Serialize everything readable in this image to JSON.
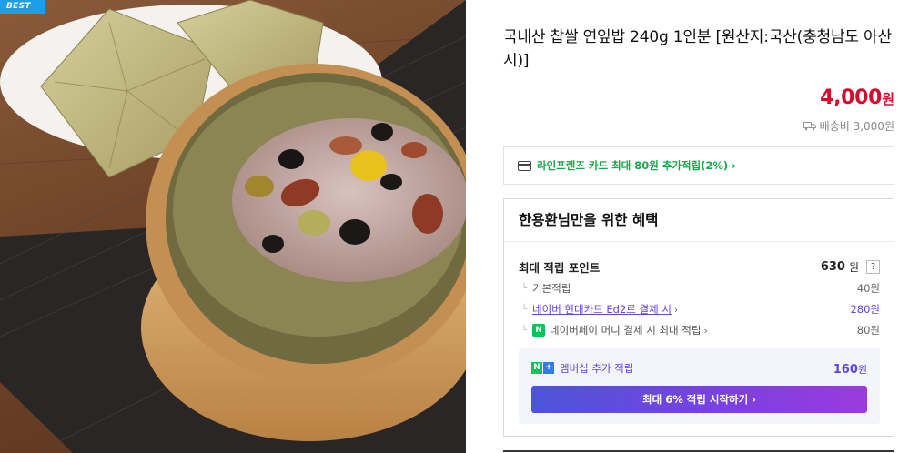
{
  "image": {
    "badge": "BEST"
  },
  "product": {
    "title": "국내산 찹쌀 연잎밥 240g 1인분 [원산지:국산(충청남도 아산시)]",
    "price": "4,000",
    "price_unit": "원",
    "shipping": "배송비 3,000원"
  },
  "card_promo": {
    "text": "라인프렌즈 카드 최대 80원 추가적립(2%) ›"
  },
  "benefits": {
    "title": "한용환님만을 위한 혜택",
    "max_points_label": "최대 적립 포인트",
    "max_points_value": "630",
    "max_points_unit": "원",
    "help": "?",
    "rows": [
      {
        "label": "기본적립",
        "value": "40원"
      },
      {
        "label": "네이버 현대카드 Ed2로 결제 시",
        "value": "280원"
      },
      {
        "label": "네이버페이 머니 결제 시 최대 적립",
        "value": "80원"
      }
    ],
    "membership_label": "멤버십 추가 적립",
    "membership_value": "160",
    "membership_unit": "원",
    "start_button": "최대 6% 적립 시작하기 ›"
  },
  "colors": {
    "price": "#d20d2e",
    "promo": "#17a94a",
    "accent": "#6442e3"
  }
}
